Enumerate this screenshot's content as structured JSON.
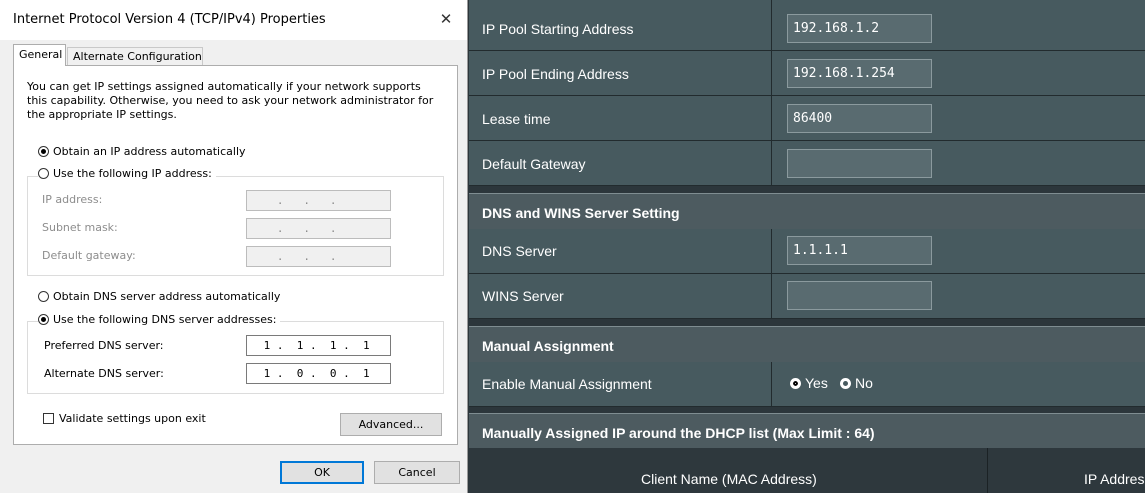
{
  "dialog": {
    "title": "Internet Protocol Version 4 (TCP/IPv4) Properties",
    "close_glyph": "✕",
    "tabs": [
      {
        "label": "General",
        "active": true
      },
      {
        "label": "Alternate Configuration",
        "active": false
      }
    ],
    "intro_text": "You can get IP settings assigned automatically if your network supports this capability. Otherwise, you need to ask your network administrator for the appropriate IP settings.",
    "ip_mode": {
      "auto_label": "Obtain an IP address automatically",
      "manual_label": "Use the following IP address:",
      "selected": "auto"
    },
    "ip_fields": [
      {
        "label": "IP address:",
        "value": "   .   .   .   "
      },
      {
        "label": "Subnet mask:",
        "value": "   .   .   .   "
      },
      {
        "label": "Default gateway:",
        "value": "   .   .   .   "
      }
    ],
    "dns_mode": {
      "auto_label": "Obtain DNS server address automatically",
      "manual_label": "Use the following DNS server addresses:",
      "selected": "manual"
    },
    "dns_fields": [
      {
        "label": "Preferred DNS server:",
        "value": " 1 .  1 .  1 .  1"
      },
      {
        "label": "Alternate DNS server:",
        "value": " 1 .  0 .  0 .  1"
      }
    ],
    "validate_label": "Validate settings upon exit",
    "validate_checked": false,
    "advanced_label": "Advanced...",
    "ok_label": "OK",
    "cancel_label": "Cancel"
  },
  "router": {
    "rows": [
      {
        "label": "IP Pool Starting Address",
        "value": "192.168.1.2"
      },
      {
        "label": "IP Pool Ending Address",
        "value": "192.168.1.254"
      },
      {
        "label": "Lease time",
        "value": "86400"
      },
      {
        "label": "Default Gateway",
        "value": ""
      }
    ],
    "dns_section_title": "DNS and WINS Server Setting",
    "dns_rows": [
      {
        "label": "DNS Server",
        "value": "1.1.1.1"
      },
      {
        "label": "WINS Server",
        "value": ""
      }
    ],
    "manual_section_title": "Manual Assignment",
    "manual_enable_label": "Enable Manual Assignment",
    "manual_yes": "Yes",
    "manual_no": "No",
    "manual_selected": "yes",
    "list_section_title": "Manually Assigned IP around the DHCP list (Max Limit : 64)",
    "table_columns": [
      "Client Name (MAC Address)",
      "IP Address"
    ]
  },
  "colors": {
    "dialog_bg": "#f0f0f0",
    "router_row_bg": "#475a5f",
    "router_page_bg": "#2c363b",
    "ok_border": "#0078d7"
  }
}
